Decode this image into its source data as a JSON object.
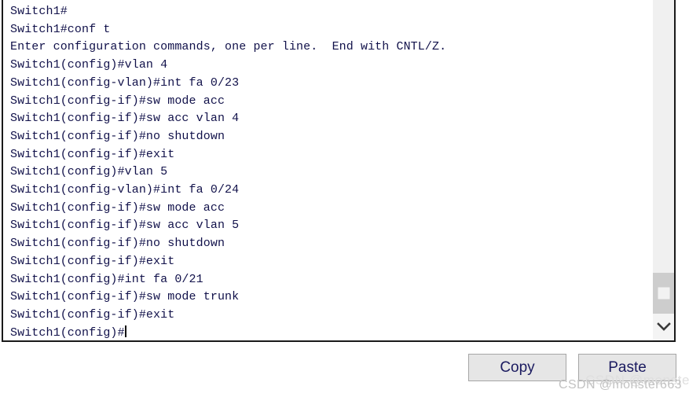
{
  "terminal": {
    "lines": [
      "Switch1#",
      "Switch1#conf t",
      "Enter configuration commands, one per line.  End with CNTL/Z.",
      "Switch1(config)#vlan 4",
      "Switch1(config-vlan)#int fa 0/23",
      "Switch1(config-if)#sw mode acc",
      "Switch1(config-if)#sw acc vlan 4",
      "Switch1(config-if)#no shutdown",
      "Switch1(config-if)#exit",
      "Switch1(config)#vlan 5",
      "Switch1(config-vlan)#int fa 0/24",
      "Switch1(config-if)#sw mode acc",
      "Switch1(config-if)#sw acc vlan 5",
      "Switch1(config-if)#no shutdown",
      "Switch1(config-if)#exit",
      "Switch1(config)#int fa 0/21",
      "Switch1(config-if)#sw mode trunk",
      "Switch1(config-if)#exit"
    ],
    "prompt_line": "Switch1(config)#",
    "text_color": "#11114a",
    "background_color": "#ffffff"
  },
  "scrollbar": {
    "track_color": "#f0f0f0",
    "thumb_color": "#cdcdcd",
    "down_icon": "chevron-down-icon"
  },
  "buttons": {
    "copy_label": "Copy",
    "paste_label": "Paste",
    "face_color": "#e6e6e6",
    "text_color": "#1b1b60"
  },
  "watermark": {
    "text": "CSDN @monster663",
    "color": "#c2c2c2"
  }
}
